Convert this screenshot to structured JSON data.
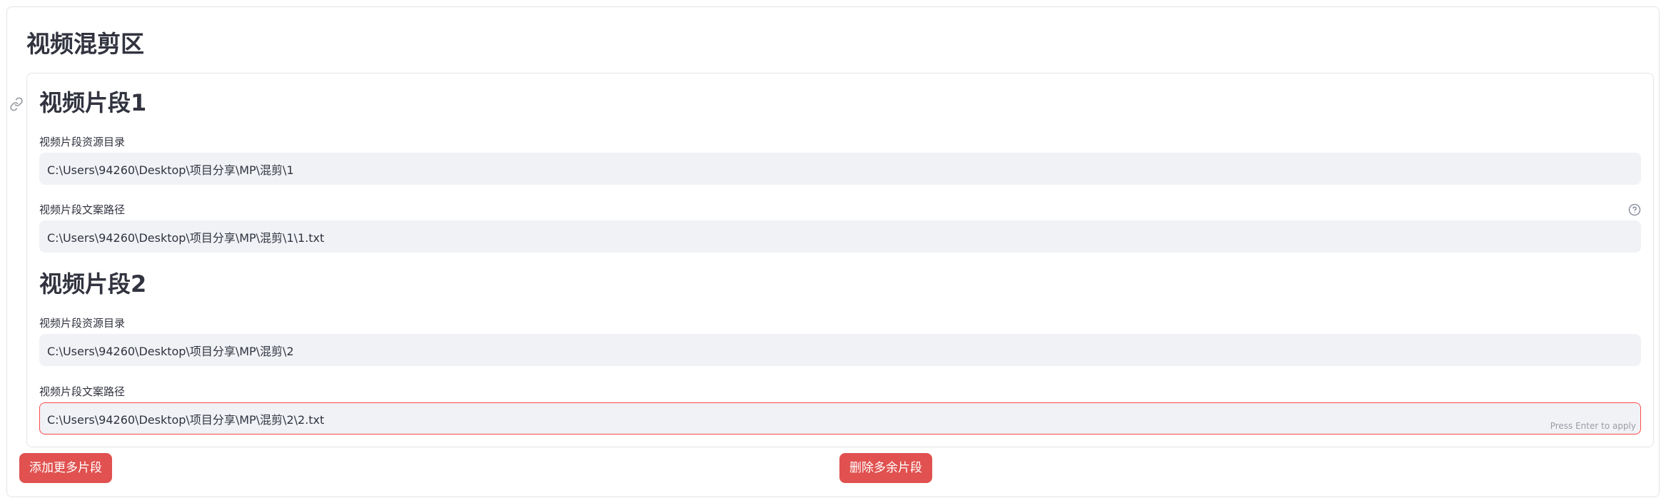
{
  "section": {
    "title": "视频混剪区"
  },
  "segments": [
    {
      "title": "视频片段1",
      "dir_label": "视频片段资源目录",
      "dir_value": "C:\\Users\\94260\\Desktop\\项目分享\\MP\\混剪\\1",
      "copy_label": "视频片段文案路径",
      "copy_value": "C:\\Users\\94260\\Desktop\\项目分享\\MP\\混剪\\1\\1.txt"
    },
    {
      "title": "视频片段2",
      "dir_label": "视频片段资源目录",
      "dir_value": "C:\\Users\\94260\\Desktop\\项目分享\\MP\\混剪\\2",
      "copy_label": "视频片段文案路径",
      "copy_value": "C:\\Users\\94260\\Desktop\\项目分享\\MP\\混剪\\2\\2.txt",
      "hint": "Press Enter to apply"
    }
  ],
  "buttons": {
    "add": "添加更多片段",
    "remove": "删除多余片段"
  },
  "icons": [
    "link-icon",
    "help-icon"
  ],
  "colors": {
    "primary_button": "#e0514f",
    "input_bg": "#f0f2f6",
    "focus_border": "#ff4b4b",
    "text": "#31333f"
  }
}
